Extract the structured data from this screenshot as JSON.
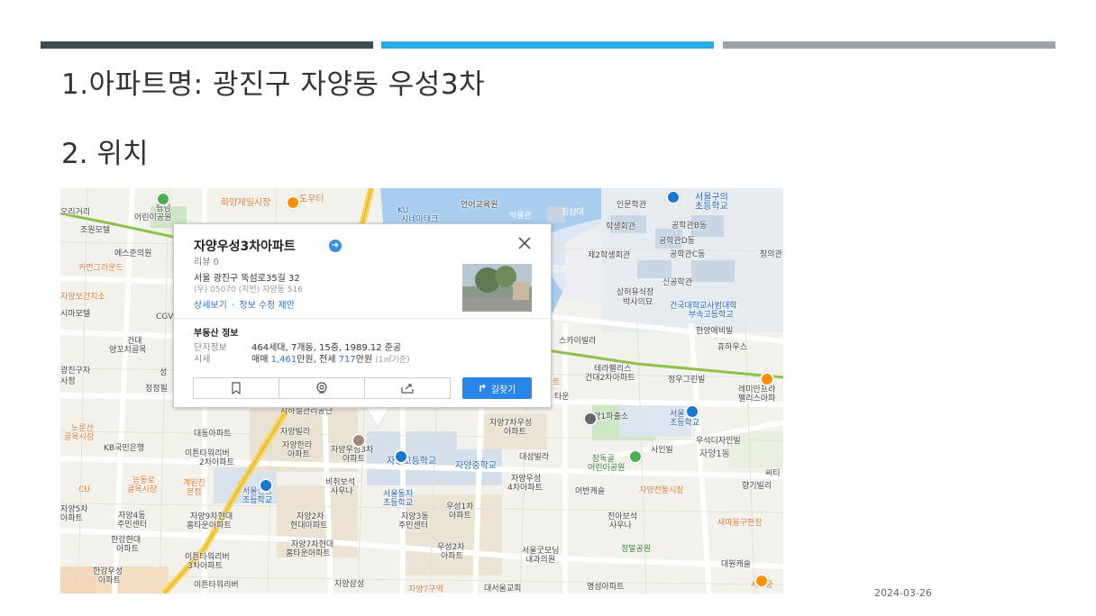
{
  "colors": {
    "bar1": "#414b52",
    "bar2": "#27aee6",
    "bar3": "#9ea3a8",
    "accent": "#2a86e9"
  },
  "slide": {
    "title": "1.아파트명: 광진구 자양동 우성3차",
    "subtitle": "2. 위치",
    "date": "2024-03-26"
  },
  "popup": {
    "name": "자양우성3차아파트",
    "review": "리뷰 0",
    "address": "서울 광진구 뚝섬로35길 32",
    "zip": "(우) 05070  (지번) 자양동 516",
    "link_detail": "상세보기",
    "link_sep": "·",
    "link_suggest": "정보 수정 제안",
    "section_title": "부동산 정보",
    "complex_label": "단지정보",
    "complex_value": "464세대, 7개동, 15층, 1989.12 준공",
    "price_label": "시세",
    "price_sale_prefix": "매매",
    "price_sale": "1,461",
    "price_sale_unit": "만원, 전세",
    "price_rent": "717",
    "price_rent_unit": "만원",
    "price_note": "(1㎡기준)",
    "route_label": "길찾기",
    "bookmark_icon": "bookmark-icon",
    "roadview_icon": "roadview-icon",
    "share_icon": "share-icon"
  },
  "map": {
    "labels": [
      {
        "t": "화양제일시장"
      },
      {
        "t": "도우터"
      },
      {
        "t": "KU"
      },
      {
        "t": "시네마테크"
      },
      {
        "t": "언어교육원"
      },
      {
        "t": "박물관"
      },
      {
        "t": "청심대"
      },
      {
        "t": "인문학관"
      },
      {
        "t": "서울구의"
      },
      {
        "t": "초등학교"
      },
      {
        "t": "학생회관"
      },
      {
        "t": "공학관B동"
      },
      {
        "t": "공학관D동"
      },
      {
        "t": "제2학생회관"
      },
      {
        "t": "공학관C동"
      },
      {
        "t": "창의관"
      },
      {
        "t": "신공학관"
      },
      {
        "t": "상허유식장"
      },
      {
        "t": "박사의묘"
      },
      {
        "t": "건국대학교사범대학"
      },
      {
        "t": "부속고등학교"
      },
      {
        "t": "한양에비빌"
      },
      {
        "t": "휴하우스"
      },
      {
        "t": "스카이빌라"
      },
      {
        "t": "테라팰리스"
      },
      {
        "t": "건대2차아파트"
      },
      {
        "t": "정우그린빌"
      },
      {
        "t": "레미안프라"
      },
      {
        "t": "팰리스아파"
      },
      {
        "t": "자양1파출소"
      },
      {
        "t": "서울자양"
      },
      {
        "t": "초등학교"
      },
      {
        "t": "자양7차우성"
      },
      {
        "t": "아파트"
      },
      {
        "t": "우석디자인빌"
      },
      {
        "t": "사인빌"
      },
      {
        "t": "자양1동"
      },
      {
        "t": "대성빌라"
      },
      {
        "t": "장독골"
      },
      {
        "t": "어린이공원"
      },
      {
        "t": "자양우성3차"
      },
      {
        "t": "아파트"
      },
      {
        "t": "자양한라"
      },
      {
        "t": "아파트"
      },
      {
        "t": "자양빌라"
      },
      {
        "t": "대동아파트"
      },
      {
        "t": "이튼타워리버"
      },
      {
        "t": "2차아파트"
      },
      {
        "t": "자양고등학교"
      },
      {
        "t": "자양중학교"
      },
      {
        "t": "자양우성"
      },
      {
        "t": "4차아파트"
      },
      {
        "t": "어반캐슬"
      },
      {
        "t": "자양전통시장"
      },
      {
        "t": "비취보석"
      },
      {
        "t": "사우나"
      },
      {
        "t": "서울신양"
      },
      {
        "t": "초등학교"
      },
      {
        "t": "서울동자"
      },
      {
        "t": "초등학교"
      },
      {
        "t": "자양9차현대"
      },
      {
        "t": "홈타운아파트"
      },
      {
        "t": "자양2차"
      },
      {
        "t": "현대아파트"
      },
      {
        "t": "자양3동"
      },
      {
        "t": "주민센터"
      },
      {
        "t": "우성1차"
      },
      {
        "t": "아파트"
      },
      {
        "t": "진아보석"
      },
      {
        "t": "사우나"
      },
      {
        "t": "새마을구판장"
      },
      {
        "t": "자양7차현대"
      },
      {
        "t": "홈타운아파트"
      },
      {
        "t": "우성2차"
      },
      {
        "t": "아파트"
      },
      {
        "t": "서울굿모닝"
      },
      {
        "t": "내과의원"
      },
      {
        "t": "정말공원"
      },
      {
        "t": "대원캐슬"
      },
      {
        "t": "한강현대"
      },
      {
        "t": "아파트"
      },
      {
        "t": "이튼타워리버"
      },
      {
        "t": "3차아파트"
      },
      {
        "t": "자양4동"
      },
      {
        "t": "주민센터"
      },
      {
        "t": "한강우성"
      },
      {
        "t": "아파트"
      },
      {
        "t": "이튼타워리버"
      },
      {
        "t": "자양삼성"
      },
      {
        "t": "자양7구역"
      },
      {
        "t": "대서울교회"
      },
      {
        "t": "명성아파트"
      },
      {
        "t": "서울중"
      },
      {
        "t": "KB국민은행"
      },
      {
        "t": "노룬산"
      },
      {
        "t": "골목시장"
      },
      {
        "t": "능동로"
      },
      {
        "t": "골목시장"
      },
      {
        "t": "계된진"
      },
      {
        "t": "본점"
      },
      {
        "t": "CU"
      },
      {
        "t": "오리거리"
      },
      {
        "t": "행님"
      },
      {
        "t": "어린이공원"
      },
      {
        "t": "조원모텔"
      },
      {
        "t": "에스준의원"
      },
      {
        "t": "커먼그라운드"
      },
      {
        "t": "자양보건지소"
      },
      {
        "t": "시마모텔"
      },
      {
        "t": "CGV"
      },
      {
        "t": "건대"
      },
      {
        "t": "양꼬치골목"
      },
      {
        "t": "성"
      },
      {
        "t": "정정필"
      },
      {
        "t": "지하철관리공단"
      },
      {
        "t": "타운"
      },
      {
        "t": "마트"
      },
      {
        "t": "사백"
      },
      {
        "t": "씨티"
      },
      {
        "t": "향기빌리"
      },
      {
        "t": "자양5차"
      },
      {
        "t": "광진구자"
      },
      {
        "t": "사정"
      },
      {
        "t": "아파트"
      },
      {
        "t": "김호"
      }
    ]
  }
}
